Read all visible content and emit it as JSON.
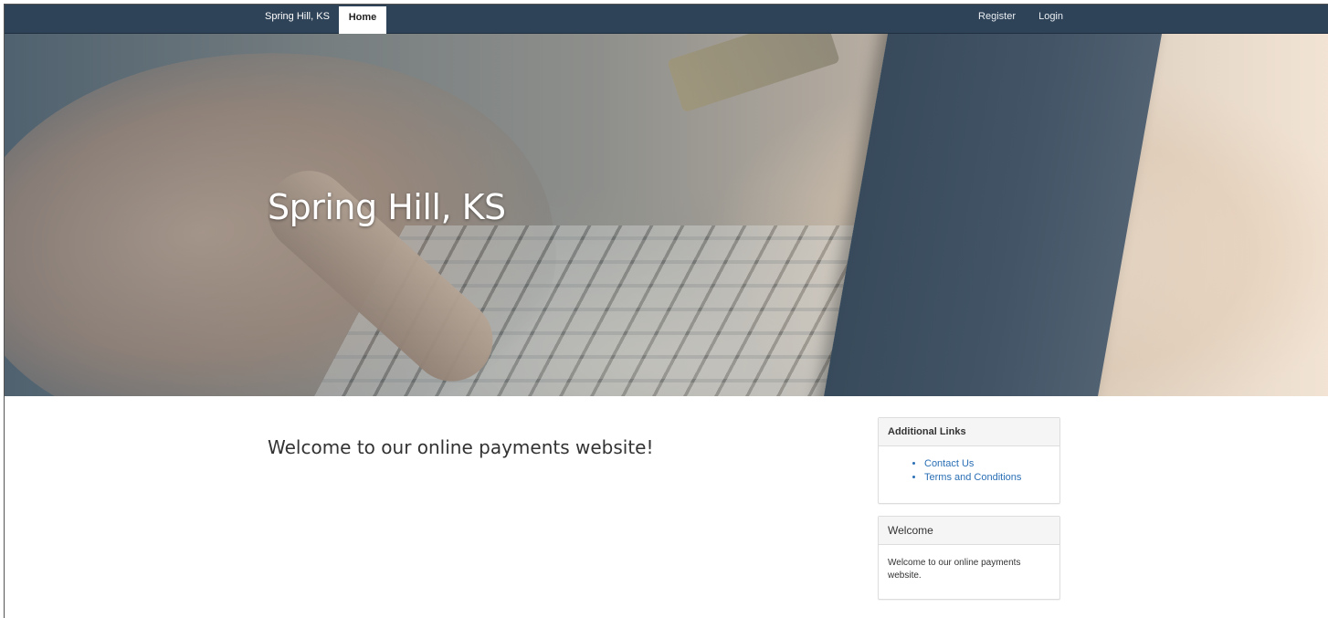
{
  "navbar": {
    "brand": "Spring Hill, KS",
    "home": "Home",
    "register": "Register",
    "login": "Login",
    "bg_color": "#2f4358"
  },
  "hero": {
    "title": "Spring Hill, KS"
  },
  "main": {
    "welcome_heading": "Welcome to our online payments website!"
  },
  "sidebar": {
    "links_panel": {
      "title": "Additional Links",
      "items": [
        "Contact Us",
        "Terms and Conditions"
      ]
    },
    "welcome_panel": {
      "title": "Welcome",
      "body": "Welcome to our online payments website."
    },
    "link_color": "#2a6fb5"
  }
}
